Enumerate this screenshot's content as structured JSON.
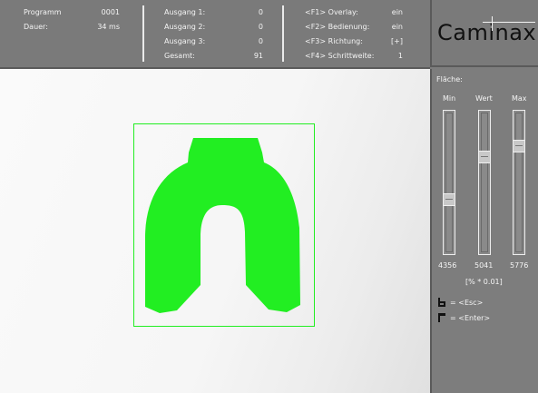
{
  "status": {
    "programm_label": "Programm",
    "programm_value": "0001",
    "dauer_label": "Dauer:",
    "dauer_value": "34 ms",
    "ausgang1_label": "Ausgang 1:",
    "ausgang1_value": "0",
    "ausgang2_label": "Ausgang 2:",
    "ausgang2_value": "0",
    "ausgang3_label": "Ausgang 3:",
    "ausgang3_value": "0",
    "gesamt_label": "Gesamt:",
    "gesamt_value": "91"
  },
  "function_keys": [
    {
      "key": "<F1> Overlay:",
      "value": "ein"
    },
    {
      "key": "<F2> Bedienung:",
      "value": "ein"
    },
    {
      "key": "<F3> Richtung:",
      "value": "[+]"
    },
    {
      "key": "<F4> Schrittweite:",
      "value": "1"
    }
  ],
  "logo": {
    "text": "Caminax"
  },
  "panel": {
    "title": "Fläche:",
    "sliders": [
      {
        "label": "Min",
        "value": "4356",
        "level": 0.38
      },
      {
        "label": "Wert",
        "value": "5041",
        "level": 0.7
      },
      {
        "label": "Max",
        "value": "5776",
        "level": 0.78
      }
    ],
    "unit": "[% * 0.01]",
    "esc_hint": "= <Esc>",
    "enter_hint": "= <Enter>"
  },
  "colors": {
    "detection": "#22ee22",
    "background": "#7d7d7d"
  }
}
